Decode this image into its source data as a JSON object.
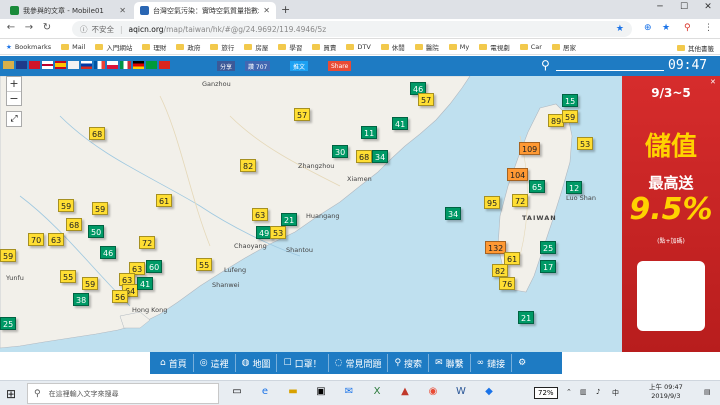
{
  "browser": {
    "tabs": [
      {
        "title": "我參與的文章 - Mobile01",
        "favicon_color": "#1a8a3a"
      },
      {
        "title": "台灣空氣污染：實時空氣質量指數地圖",
        "favicon_color": "#2a66b3"
      }
    ],
    "address": {
      "insecure_label": "不安全",
      "host": "aqicn.org",
      "path": "/map/taiwan/hk/#@g/24.9692/119.4946/5z"
    },
    "bookmarks": [
      "Bookmarks",
      "Mail",
      "入門網站",
      "理財",
      "政府",
      "旅行",
      "房屋",
      "學習",
      "買賣",
      "DTV",
      "休閒",
      "醫院",
      "My",
      "電視劇",
      "Car",
      "居家"
    ],
    "bookmarks_right": "其他書籤"
  },
  "site": {
    "flags": [
      "#1f77b4",
      "#cf142b",
      "#ffffff",
      "#c60b1e",
      "#003399",
      "#0055a4",
      "#009246",
      "#ffffff",
      "#d52b1e",
      "#da0000",
      "#009b3a",
      "#ffcd00",
      "#da251d"
    ],
    "share": {
      "facebook": "分享",
      "like": "讚 707",
      "twitter": "推文",
      "share": "Share"
    },
    "clock": "09:47"
  },
  "map": {
    "places": [
      {
        "name": "Ganzhou"
      },
      {
        "name": "Zhangzhou"
      },
      {
        "name": "Xiamen"
      },
      {
        "name": "Huangang"
      },
      {
        "name": "Chaoyang"
      },
      {
        "name": "Shantou"
      },
      {
        "name": "Lufeng"
      },
      {
        "name": "Shanwei"
      },
      {
        "name": "Yunfu"
      },
      {
        "name": "Hong Kong"
      },
      {
        "name": "TAIWAN"
      },
      {
        "name": "Luo Shan"
      }
    ],
    "stations": [
      {
        "aqi": "46"
      },
      {
        "aqi": "57"
      },
      {
        "aqi": "57"
      },
      {
        "aqi": "11"
      },
      {
        "aqi": "41"
      },
      {
        "aqi": "68"
      },
      {
        "aqi": "30"
      },
      {
        "aqi": "68"
      },
      {
        "aqi": "34"
      },
      {
        "aqi": "82"
      },
      {
        "aqi": "61"
      },
      {
        "aqi": "59"
      },
      {
        "aqi": "59"
      },
      {
        "aqi": "63"
      },
      {
        "aqi": "21"
      },
      {
        "aqi": "49"
      },
      {
        "aqi": "53"
      },
      {
        "aqi": "68"
      },
      {
        "aqi": "50"
      },
      {
        "aqi": "70"
      },
      {
        "aqi": "63"
      },
      {
        "aqi": "72"
      },
      {
        "aqi": "46"
      },
      {
        "aqi": "59"
      },
      {
        "aqi": "63"
      },
      {
        "aqi": "60"
      },
      {
        "aqi": "55"
      },
      {
        "aqi": "63"
      },
      {
        "aqi": "59"
      },
      {
        "aqi": "64"
      },
      {
        "aqi": "41"
      },
      {
        "aqi": "56"
      },
      {
        "aqi": "38"
      },
      {
        "aqi": "55"
      },
      {
        "aqi": "25"
      },
      {
        "aqi": "15"
      },
      {
        "aqi": "89"
      },
      {
        "aqi": "59"
      },
      {
        "aqi": "53"
      },
      {
        "aqi": "109"
      },
      {
        "aqi": "104"
      },
      {
        "aqi": "65"
      },
      {
        "aqi": "12"
      },
      {
        "aqi": "95"
      },
      {
        "aqi": "72"
      },
      {
        "aqi": "34"
      },
      {
        "aqi": "132"
      },
      {
        "aqi": "25"
      },
      {
        "aqi": "61"
      },
      {
        "aqi": "82"
      },
      {
        "aqi": "17"
      },
      {
        "aqi": "76"
      },
      {
        "aqi": "21"
      }
    ],
    "colors": {
      "good": "#009966",
      "moderate": "#ffde33",
      "sensitive": "#ff9933",
      "unhealthy": "#cc0033"
    }
  },
  "ad": {
    "date": "9/3~5",
    "title": "儲值",
    "subtitle": "最高送",
    "percent": "9.5%",
    "note": "(點+加碼)"
  },
  "bottom_nav": [
    {
      "icon": "home-icon",
      "label": "首頁"
    },
    {
      "icon": "compass-icon",
      "label": "這裡"
    },
    {
      "icon": "globe-icon",
      "label": "地圖"
    },
    {
      "icon": "mask-icon",
      "label": "口罩！"
    },
    {
      "icon": "question-icon",
      "label": "常見問題"
    },
    {
      "icon": "search-icon",
      "label": "搜索"
    },
    {
      "icon": "contact-icon",
      "label": "聯繫"
    },
    {
      "icon": "link-icon",
      "label": "鏈接"
    },
    {
      "icon": "gear-icon",
      "label": ""
    }
  ],
  "taskbar": {
    "search_placeholder": "在這裡輸入文字來搜尋",
    "battery": "72%",
    "ime": "中",
    "time": "上午 09:47",
    "date": "2019/9/3"
  }
}
